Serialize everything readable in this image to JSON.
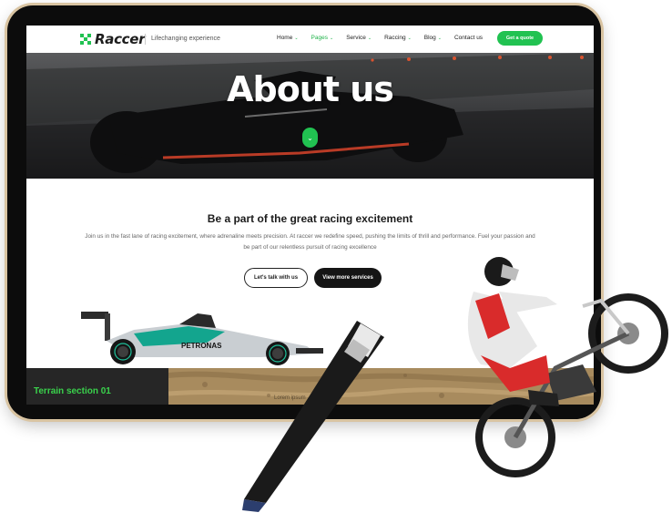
{
  "header": {
    "logo_text": "Raccer",
    "tagline": "Lifechanging experience",
    "nav": [
      {
        "label": "Home",
        "has_caret": true,
        "active": false
      },
      {
        "label": "Pages",
        "has_caret": true,
        "active": true
      },
      {
        "label": "Service",
        "has_caret": true,
        "active": false
      },
      {
        "label": "Raccing",
        "has_caret": true,
        "active": false
      },
      {
        "label": "Blog",
        "has_caret": true,
        "active": false
      },
      {
        "label": "Contact us",
        "has_caret": false,
        "active": false
      }
    ],
    "cta_label": "Get a quote",
    "caret_glyph": "⌄"
  },
  "hero": {
    "title": "About us",
    "scroll_icon": "chevron-down-icon",
    "scroll_glyph": "⌄"
  },
  "section": {
    "heading": "Be a part of the great racing excitement",
    "text": "Join us in the fast lane of racing excitement, where adrenaline meets precision. At raccer we redefine speed, pushing the limits of thrill and performance. Fuel your passion and be part of our relentless pursuit of racing excellence",
    "button_primary": "Let's talk with us",
    "button_secondary": "View more services"
  },
  "car": {
    "sponsor_text": "PETRONAS"
  },
  "terrain": {
    "label": "Terrain section 01",
    "caption": "Lorem ipsum"
  },
  "colors": {
    "accent": "#21c251",
    "dark": "#151515",
    "frame_gold": "#d9c4a2",
    "terrain_brown": "#a88b5e"
  }
}
